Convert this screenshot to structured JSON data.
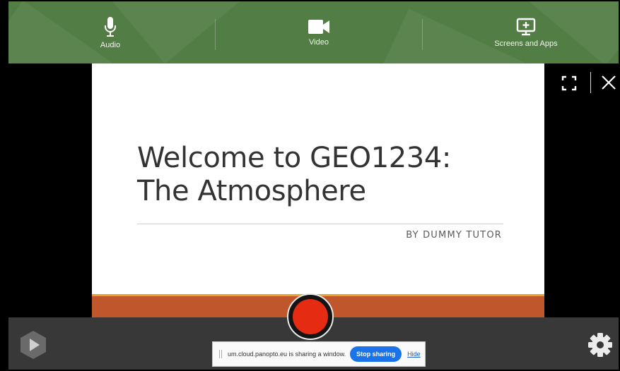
{
  "toolbar": {
    "audio_label": "Audio",
    "video_label": "Video",
    "screens_label": "Screens and Apps"
  },
  "slide": {
    "title_line1": "Welcome to GEO1234:",
    "title_line2": "The Atmosphere",
    "subtitle": "BY DUMMY TUTOR"
  },
  "share_bar": {
    "message": "um.cloud.panopto.eu is sharing a window.",
    "stop_label": "Stop sharing",
    "hide_label": "Hide"
  },
  "icons": {
    "audio": "microphone-icon",
    "video": "video-camera-icon",
    "screens": "screen-add-icon",
    "expand": "expand-icon",
    "close": "close-icon",
    "logo": "panopto-logo-icon",
    "settings": "gear-icon",
    "record": "record-button"
  },
  "colors": {
    "toolbar": "#527d44",
    "record": "#e52b12",
    "slide_stripe": "#c0572c",
    "slide_stripe_accent": "#e7a12d",
    "stop_button": "#1a73e8"
  }
}
